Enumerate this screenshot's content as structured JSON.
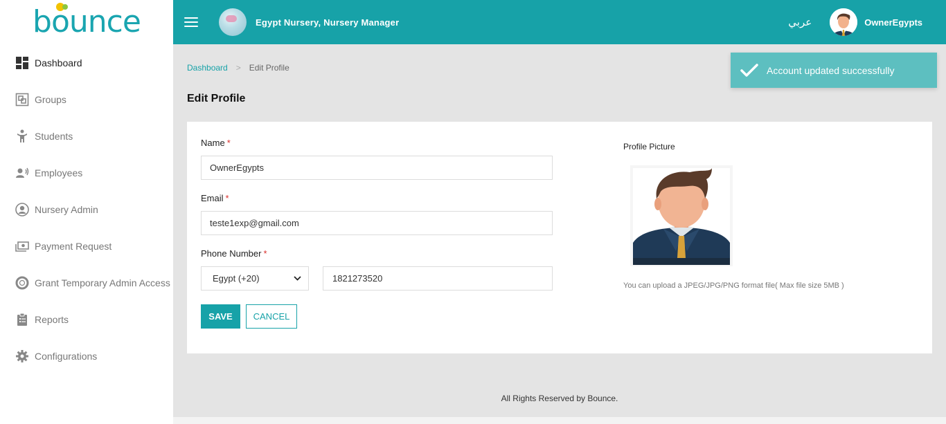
{
  "brand": {
    "logo_text_before": "b",
    "logo_text_after": "unce",
    "logo_o": "o"
  },
  "colors": {
    "accent": "#17a2a8",
    "toast": "#5dbfc0",
    "required": "#d9302c"
  },
  "sidebar": {
    "items": [
      {
        "label": "Dashboard",
        "icon": "dashboard-icon"
      },
      {
        "label": "Groups",
        "icon": "groups-icon"
      },
      {
        "label": "Students",
        "icon": "student-icon"
      },
      {
        "label": "Employees",
        "icon": "employees-icon"
      },
      {
        "label": "Nursery Admin",
        "icon": "admin-user-icon"
      },
      {
        "label": "Payment Request",
        "icon": "money-icon"
      },
      {
        "label": "Grant Temporary Admin Access",
        "icon": "lifebuoy-icon"
      },
      {
        "label": "Reports",
        "icon": "clipboard-icon"
      },
      {
        "label": "Configurations",
        "icon": "gear-icon"
      }
    ]
  },
  "header": {
    "nursery_title": "Egypt Nursery, Nursery Manager",
    "language": "عربي",
    "username": "OwnerEgypts"
  },
  "toast": {
    "message": "Account updated successfully"
  },
  "breadcrumb": {
    "home": "Dashboard",
    "current": "Edit Profile"
  },
  "page": {
    "title": "Edit Profile"
  },
  "form": {
    "name_label": "Name",
    "name_value": "OwnerEgypts",
    "email_label": "Email",
    "email_value": "teste1exp@gmail.com",
    "phone_label": "Phone Number",
    "country_value": "Egypt (+20)",
    "phone_value": "1821273520",
    "required_mark": "*",
    "save_label": "SAVE",
    "cancel_label": "CANCEL"
  },
  "profile_picture": {
    "label": "Profile Picture",
    "hint": "You can upload a JPEG/JPG/PNG format file( Max file size 5MB )"
  },
  "footer": {
    "text": "All Rights Reserved by Bounce."
  }
}
